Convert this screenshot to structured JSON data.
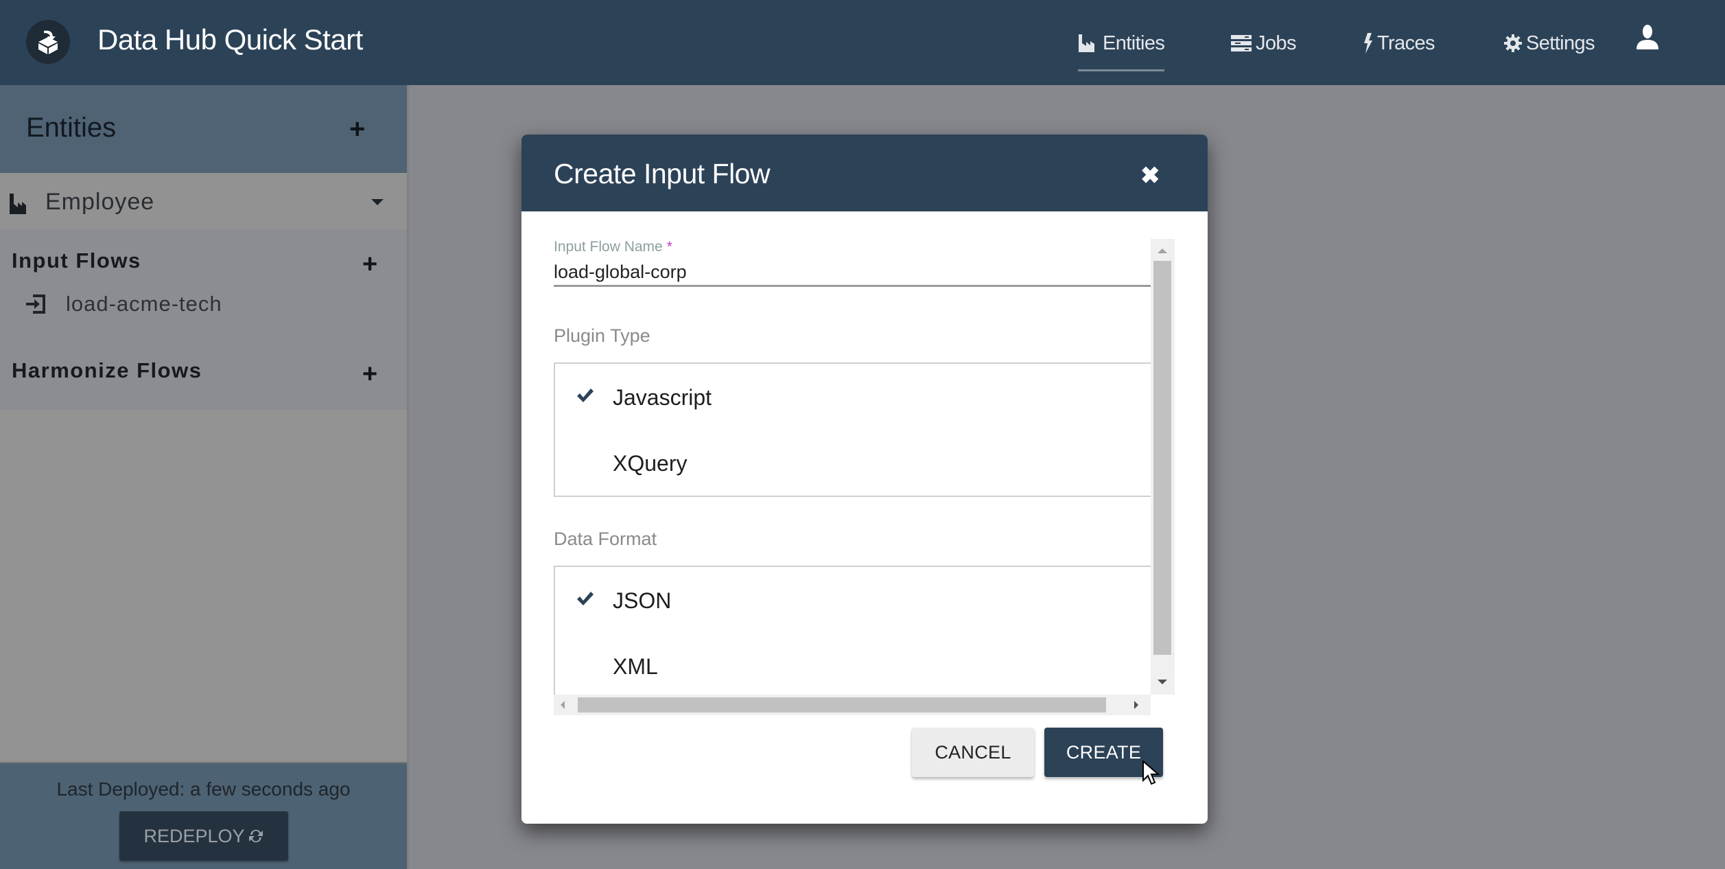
{
  "app": {
    "title": "Data Hub Quick Start",
    "logo_icon": "box-arrow-logo-icon"
  },
  "nav": {
    "items": [
      {
        "label": "Entities",
        "icon": "factory-chart-icon",
        "active": true
      },
      {
        "label": "Jobs",
        "icon": "server-stack-icon",
        "active": false
      },
      {
        "label": "Traces",
        "icon": "lightning-bolt-icon",
        "active": false
      },
      {
        "label": "Settings",
        "icon": "gear-icon",
        "active": false
      }
    ],
    "user_icon": "user-icon"
  },
  "sidebar": {
    "title": "Entities",
    "add_icon": "plus-icon",
    "entity": {
      "label": "Employee",
      "icon": "factory-chart-icon",
      "expand_icon": "caret-down-icon"
    },
    "input_flows": {
      "title": "Input Flows",
      "items": [
        {
          "label": "load-acme-tech",
          "icon": "sign-in-icon"
        }
      ]
    },
    "harmonize_flows": {
      "title": "Harmonize Flows",
      "items": []
    },
    "footer": {
      "last_deployed": "Last Deployed: a few seconds ago",
      "redeploy_label": "REDEPLOY",
      "redeploy_icon": "refresh-icon"
    }
  },
  "dialog": {
    "title": "Create Input Flow",
    "close_icon": "close-icon",
    "name_field": {
      "label": "Input Flow Name",
      "required_mark": "*",
      "value": "load-global-corp"
    },
    "plugin_type": {
      "label": "Plugin Type",
      "options": [
        {
          "label": "Javascript",
          "selected": true
        },
        {
          "label": "XQuery",
          "selected": false
        }
      ]
    },
    "data_format": {
      "label": "Data Format",
      "options": [
        {
          "label": "JSON",
          "selected": true
        },
        {
          "label": "XML",
          "selected": false
        }
      ]
    },
    "cancel_label": "CANCEL",
    "create_label": "CREATE"
  },
  "colors": {
    "header_bg": "#2c4257",
    "overlay": "#87888d",
    "primary_button": "#2c4257",
    "required_mark": "#c040c0",
    "check": "#2c4257"
  }
}
